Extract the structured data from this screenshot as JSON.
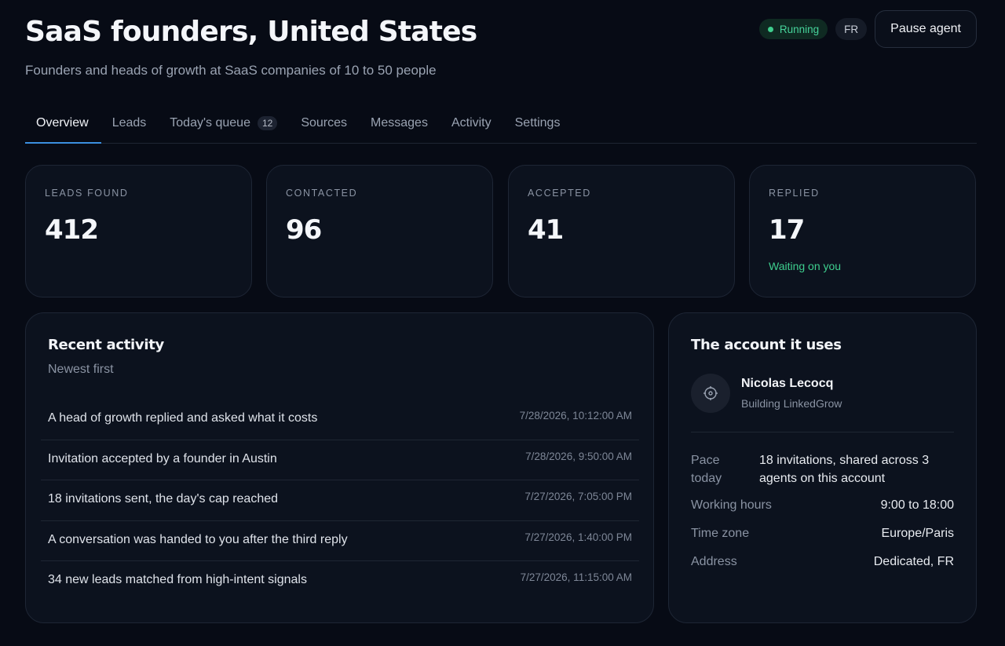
{
  "header": {
    "title": "SaaS founders, United States",
    "subtitle": "Founders and heads of growth at SaaS companies of 10 to 50 people",
    "status": "Running",
    "language": "FR",
    "pause_label": "Pause agent"
  },
  "tabs": [
    {
      "label": "Overview",
      "active": true
    },
    {
      "label": "Leads"
    },
    {
      "label": "Today's queue",
      "badge": "12"
    },
    {
      "label": "Sources"
    },
    {
      "label": "Messages"
    },
    {
      "label": "Activity"
    },
    {
      "label": "Settings"
    }
  ],
  "stats": [
    {
      "label": "LEADS FOUND",
      "value": "412"
    },
    {
      "label": "CONTACTED",
      "value": "96"
    },
    {
      "label": "ACCEPTED",
      "value": "41"
    },
    {
      "label": "REPLIED",
      "value": "17",
      "note": "Waiting on you"
    }
  ],
  "activity": {
    "title": "Recent activity",
    "subtitle": "Newest first",
    "items": [
      {
        "text": "A head of growth replied and asked what it costs",
        "time": "7/28/2026, 10:12:00 AM"
      },
      {
        "text": "Invitation accepted by a founder in Austin",
        "time": "7/28/2026, 9:50:00 AM"
      },
      {
        "text": "18 invitations sent, the day's cap reached",
        "time": "7/27/2026, 7:05:00 PM"
      },
      {
        "text": "A conversation was handed to you after the third reply",
        "time": "7/27/2026, 1:40:00 PM"
      },
      {
        "text": "34 new leads matched from high-intent signals",
        "time": "7/27/2026, 11:15:00 AM"
      }
    ]
  },
  "account": {
    "title": "The account it uses",
    "name": "Nicolas Lecocq",
    "role": "Building LinkedGrow",
    "avatar_icon": "crosshair-icon",
    "pace_key": "Pace today",
    "pace_val": "18 invitations, shared across 3 agents on this account",
    "hours_key": "Working hours",
    "hours_val": "9:00 to 18:00",
    "tz_key": "Time zone",
    "tz_val": "Europe/Paris",
    "addr_key": "Address",
    "addr_val": "Dedicated, FR"
  },
  "colors": {
    "background": "#070b15",
    "card": "#0c121e",
    "accent_tab": "#3b8fe0",
    "status_green": "#3ecf8e"
  }
}
